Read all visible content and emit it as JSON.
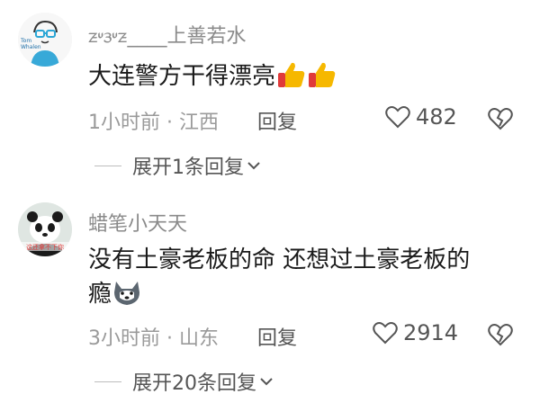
{
  "comments": [
    {
      "username": "ᤏᤸᤋᤸᤏ____上善若水",
      "avatar_text": "Tom Whalen",
      "text": "大连警方干得漂亮",
      "emoji_icons": [
        "thumbs-up-icon",
        "thumbs-up-icon"
      ],
      "time": "1小时前",
      "location": "江西",
      "reply_label": "回复",
      "likes": "482",
      "expand_label": "展开1条回复"
    },
    {
      "username": "蜡笔小天天",
      "avatar_text": "这还拿不下你",
      "text_line1": "没有土豪老板的命 还想过土豪老板的",
      "text_line2": "瘾",
      "emoji_icons": [
        "husky-dog-icon"
      ],
      "time": "3小时前",
      "location": "山东",
      "reply_label": "回复",
      "likes": "2914",
      "expand_label": "展开20条回复"
    }
  ],
  "separator": " · ",
  "colors": {
    "text": "#1a1a1a",
    "muted": "#9a9a9a",
    "username": "#8a8a8a",
    "thumb": "#f3b200"
  }
}
